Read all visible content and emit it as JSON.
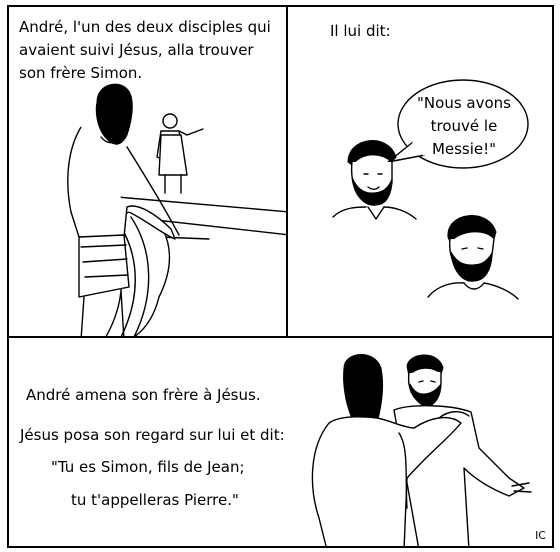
{
  "panels": {
    "p1": {
      "caption": "André, l'un des deux disciples qui avaient suivi Jésus, alla trouver son frère Simon."
    },
    "p2": {
      "caption": "Il lui dit:",
      "bubble": [
        "\"Nous avons",
        "trouvé le",
        "Messie!\""
      ]
    },
    "p3": {
      "lines": [
        "André amena son frère à Jésus.",
        "Jésus posa son regard sur lui et dit:",
        "\"Tu es Simon, fils de Jean;",
        "tu t'appelleras Pierre.\""
      ],
      "signature": "IC"
    }
  }
}
